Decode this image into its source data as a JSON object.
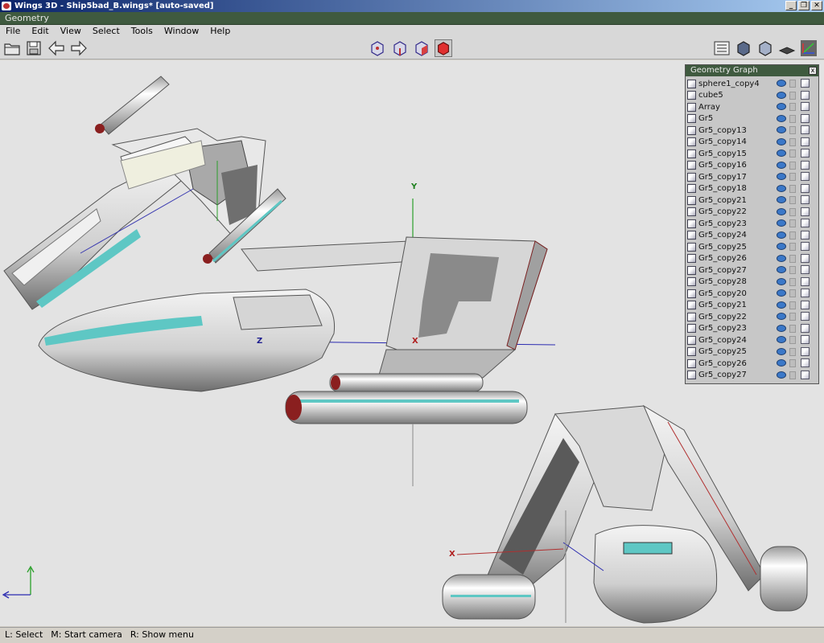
{
  "window": {
    "title": "Wings 3D - Ship5bad_B.wings* [auto-saved]",
    "buttons": [
      "_",
      "❐",
      "✕"
    ]
  },
  "geometry_header": "Geometry",
  "menu": [
    "File",
    "Edit",
    "View",
    "Select",
    "Tools",
    "Window",
    "Help"
  ],
  "viewport_axes": {
    "y": "Y",
    "z": "Z",
    "x": "X",
    "x2": "X"
  },
  "geometry_graph": {
    "title": "Geometry Graph",
    "close": "x",
    "objects": [
      "sphere1_copy4",
      "cube5",
      "Array",
      "Gr5",
      "Gr5_copy13",
      "Gr5_copy14",
      "Gr5_copy15",
      "Gr5_copy16",
      "Gr5_copy17",
      "Gr5_copy18",
      "Gr5_copy21",
      "Gr5_copy22",
      "Gr5_copy23",
      "Gr5_copy24",
      "Gr5_copy25",
      "Gr5_copy26",
      "Gr5_copy27",
      "Gr5_copy28",
      "Gr5_copy20",
      "Gr5_copy21",
      "Gr5_copy22",
      "Gr5_copy23",
      "Gr5_copy24",
      "Gr5_copy25",
      "Gr5_copy26",
      "Gr5_copy27"
    ]
  },
  "status": {
    "left": "L: Select",
    "middle": "M: Start camera",
    "right": "R: Show menu"
  },
  "colors": {
    "title_bar": "#0a246a",
    "header": "#3f5a3f",
    "viewport": "#e3e3e3",
    "accent_teal": "#5ec7c4",
    "red_tip": "#8a1f1f"
  }
}
